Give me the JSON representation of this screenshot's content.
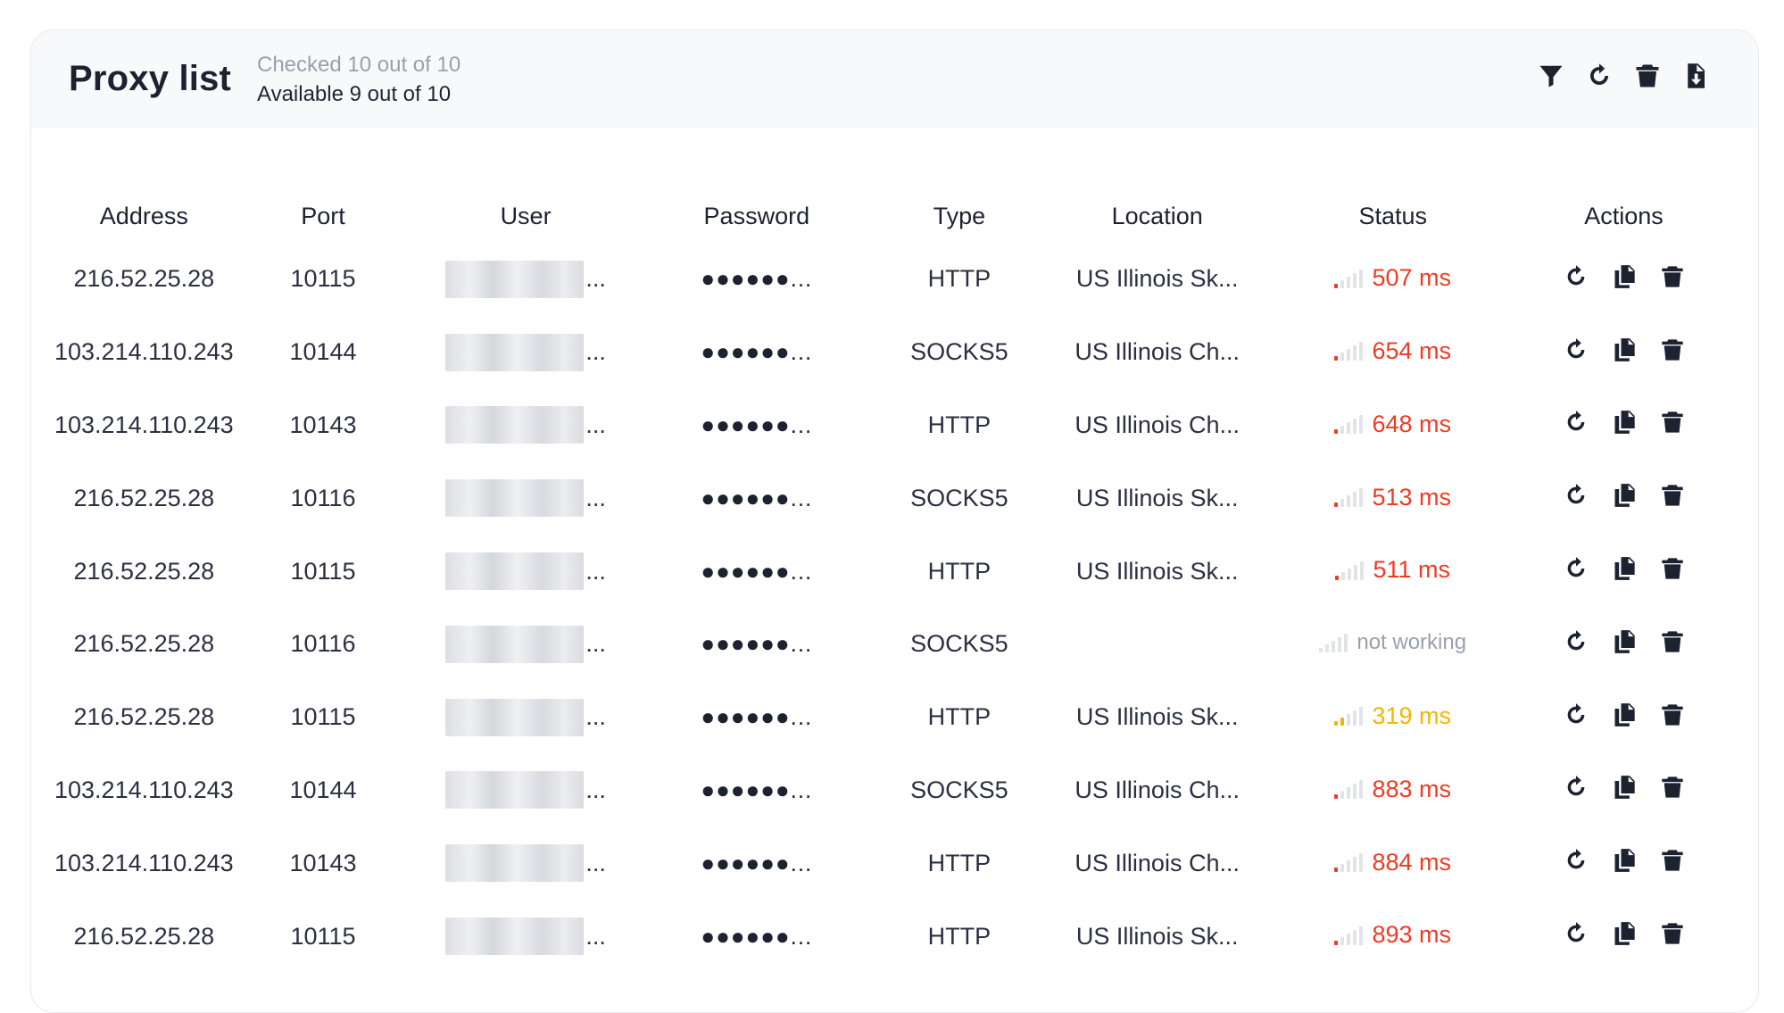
{
  "header": {
    "title": "Proxy list",
    "checked": "Checked 10 out of 10",
    "available": "Available 9 out of 10",
    "tools": [
      "filter-icon",
      "refresh-icon",
      "trash-icon",
      "export-file-icon"
    ]
  },
  "columns": {
    "address": "Address",
    "port": "Port",
    "user": "User",
    "password": "Password",
    "type": "Type",
    "location": "Location",
    "status": "Status",
    "actions": "Actions"
  },
  "masks": {
    "ellipsis": "...",
    "password": "●●●●●●..."
  },
  "colors": {
    "slow": "#ef3b24",
    "medium": "#f2b600",
    "offline": "#9aa0ab"
  },
  "rows": [
    {
      "address": "216.52.25.28",
      "port": "10115",
      "type": "HTTP",
      "location": "US Illinois Sk...",
      "status": "507 ms",
      "level": "red"
    },
    {
      "address": "103.214.110.243",
      "port": "10144",
      "type": "SOCKS5",
      "location": "US Illinois Ch...",
      "status": "654 ms",
      "level": "red"
    },
    {
      "address": "103.214.110.243",
      "port": "10143",
      "type": "HTTP",
      "location": "US Illinois Ch...",
      "status": "648 ms",
      "level": "red"
    },
    {
      "address": "216.52.25.28",
      "port": "10116",
      "type": "SOCKS5",
      "location": "US Illinois Sk...",
      "status": "513 ms",
      "level": "red"
    },
    {
      "address": "216.52.25.28",
      "port": "10115",
      "type": "HTTP",
      "location": "US Illinois Sk...",
      "status": "511 ms",
      "level": "red"
    },
    {
      "address": "216.52.25.28",
      "port": "10116",
      "type": "SOCKS5",
      "location": "",
      "status": "not working",
      "level": "grey"
    },
    {
      "address": "216.52.25.28",
      "port": "10115",
      "type": "HTTP",
      "location": "US Illinois Sk...",
      "status": "319 ms",
      "level": "yellow"
    },
    {
      "address": "103.214.110.243",
      "port": "10144",
      "type": "SOCKS5",
      "location": "US Illinois Ch...",
      "status": "883 ms",
      "level": "red"
    },
    {
      "address": "103.214.110.243",
      "port": "10143",
      "type": "HTTP",
      "location": "US Illinois Ch...",
      "status": "884 ms",
      "level": "red"
    },
    {
      "address": "216.52.25.28",
      "port": "10115",
      "type": "HTTP",
      "location": "US Illinois Sk...",
      "status": "893 ms",
      "level": "red"
    }
  ]
}
